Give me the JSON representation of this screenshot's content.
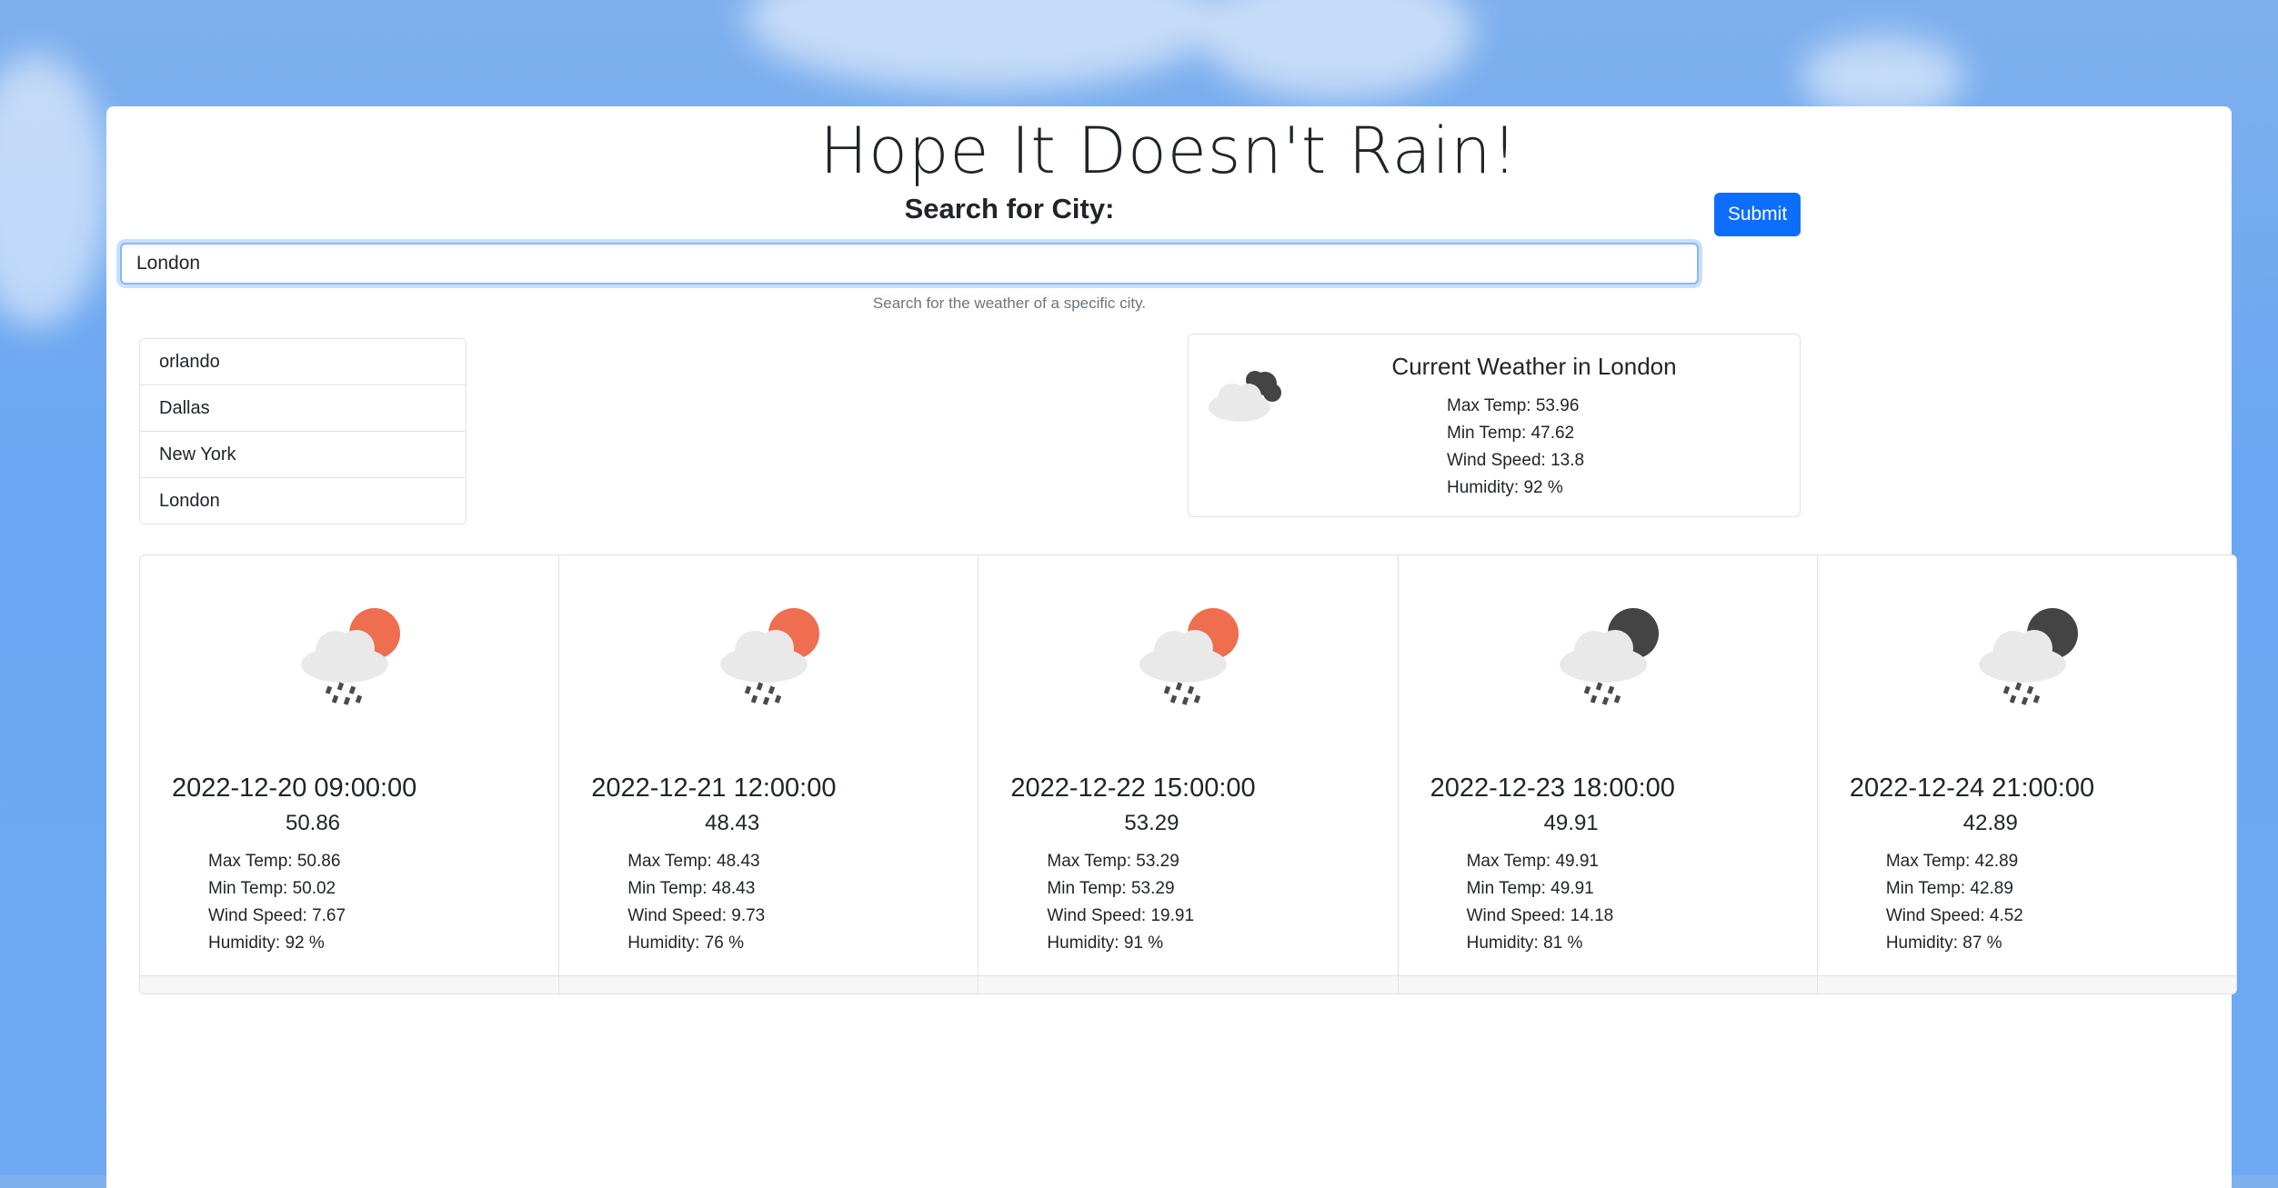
{
  "header": {
    "title": "Hope It Doesn't Rain!"
  },
  "search": {
    "label": "Search for City:",
    "value": "London",
    "help": "Search for the weather of a specific city.",
    "submit_label": "Submit"
  },
  "history": {
    "items": [
      {
        "label": "orlando"
      },
      {
        "label": "Dallas"
      },
      {
        "label": "New York"
      },
      {
        "label": "London"
      }
    ]
  },
  "current": {
    "icon": "cloud-moon-icon",
    "title": "Current Weather in London",
    "max": "Max Temp: 53.96",
    "min": "Min Temp: 47.62",
    "wind": "Wind Speed: 13.8",
    "humidity": "Humidity: 92 %"
  },
  "forecast": [
    {
      "icon": "rain-sun-icon",
      "date": "2022-12-20 09:00:00",
      "temp": "50.86",
      "max": "Max Temp: 50.86",
      "min": "Min Temp: 50.02",
      "wind": "Wind Speed: 7.67",
      "humidity": "Humidity: 92 %"
    },
    {
      "icon": "rain-sun-icon",
      "date": "2022-12-21 12:00:00",
      "temp": "48.43",
      "max": "Max Temp: 48.43",
      "min": "Min Temp: 48.43",
      "wind": "Wind Speed: 9.73",
      "humidity": "Humidity: 76 %"
    },
    {
      "icon": "rain-sun-icon",
      "date": "2022-12-22 15:00:00",
      "temp": "53.29",
      "max": "Max Temp: 53.29",
      "min": "Min Temp: 53.29",
      "wind": "Wind Speed: 19.91",
      "humidity": "Humidity: 91 %"
    },
    {
      "icon": "rain-moon-icon",
      "date": "2022-12-23 18:00:00",
      "temp": "49.91",
      "max": "Max Temp: 49.91",
      "min": "Min Temp: 49.91",
      "wind": "Wind Speed: 14.18",
      "humidity": "Humidity: 81 %"
    },
    {
      "icon": "rain-moon-icon",
      "date": "2022-12-24 21:00:00",
      "temp": "42.89",
      "max": "Max Temp: 42.89",
      "min": "Min Temp: 42.89",
      "wind": "Wind Speed: 4.52",
      "humidity": "Humidity: 87 %"
    }
  ],
  "colors": {
    "accent": "#0d6efd",
    "sun": "#ee6e4f",
    "moon": "#444444",
    "cloud": "#e9e9e9"
  }
}
